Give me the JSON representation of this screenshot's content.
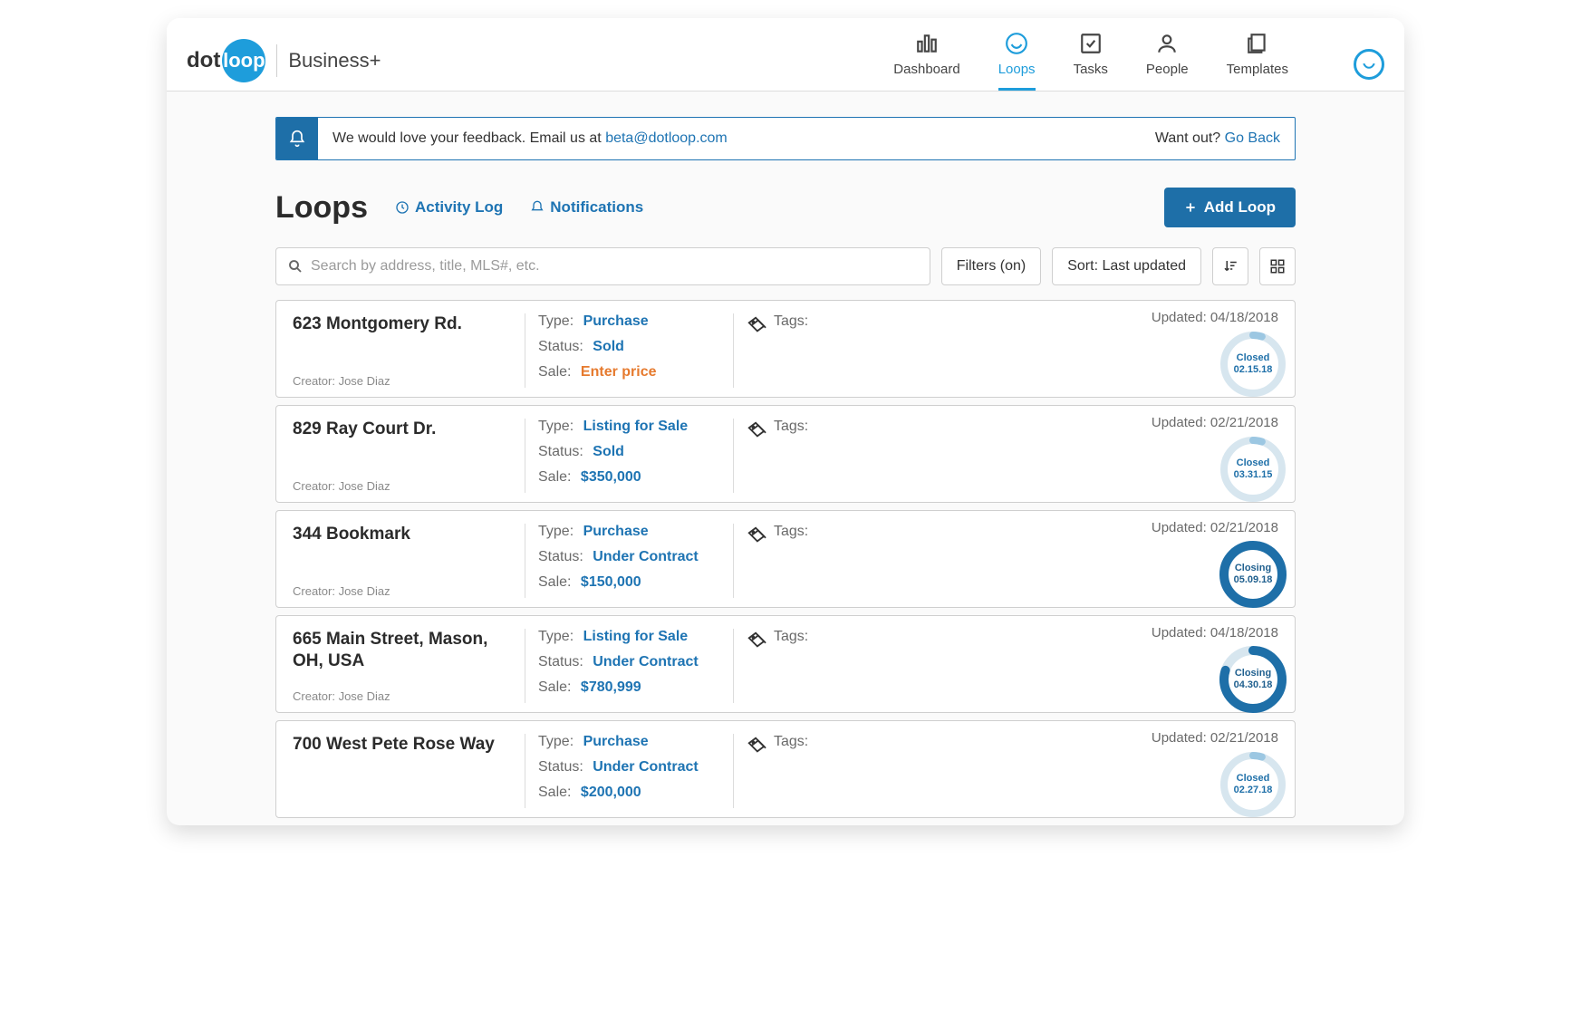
{
  "brand": {
    "dot": "dot",
    "loop": "loop",
    "plan": "Business+"
  },
  "nav": {
    "items": [
      {
        "label": "Dashboard"
      },
      {
        "label": "Loops"
      },
      {
        "label": "Tasks"
      },
      {
        "label": "People"
      },
      {
        "label": "Templates"
      }
    ]
  },
  "alert": {
    "text_prefix": "We would love your feedback. Email us at ",
    "email": "beta@dotloop.com",
    "wantout_prefix": "Want out? ",
    "wantout_link": "Go Back"
  },
  "page": {
    "title": "Loops",
    "activity_link": "Activity Log",
    "notifications_link": "Notifications",
    "add_button": "Add Loop"
  },
  "toolbar": {
    "search_placeholder": "Search by address, title, MLS#, etc.",
    "filters_label": "Filters (on)",
    "sort_label": "Sort: Last updated"
  },
  "labels": {
    "type": "Type:",
    "status": "Status:",
    "sale": "Sale:",
    "tags": "Tags:",
    "updated": "Updated:",
    "creator": "Creator:"
  },
  "loops": [
    {
      "address": "623 Montgomery Rd.",
      "creator": "Jose Diaz",
      "type": "Purchase",
      "status": "Sold",
      "sale": "Enter price",
      "sale_is_warn": true,
      "updated": "04/18/2018",
      "ring": {
        "label": "Closed",
        "date": "02.15.18",
        "pct": 5,
        "style": "thin"
      }
    },
    {
      "address": "829 Ray Court Dr.",
      "creator": "Jose Diaz",
      "type": "Listing for Sale",
      "status": "Sold",
      "sale": "$350,000",
      "sale_is_warn": false,
      "updated": "02/21/2018",
      "ring": {
        "label": "Closed",
        "date": "03.31.15",
        "pct": 5,
        "style": "thin"
      }
    },
    {
      "address": "344 Bookmark",
      "creator": "Jose Diaz",
      "type": "Purchase",
      "status": "Under Contract",
      "sale": "$150,000",
      "sale_is_warn": false,
      "updated": "02/21/2018",
      "ring": {
        "label": "Closing",
        "date": "05.09.18",
        "pct": 100,
        "style": "thick"
      }
    },
    {
      "address": "665 Main Street, Mason, OH, USA",
      "creator": "Jose Diaz",
      "type": "Listing for Sale",
      "status": "Under Contract",
      "sale": "$780,999",
      "sale_is_warn": false,
      "updated": "04/18/2018",
      "ring": {
        "label": "Closing",
        "date": "04.30.18",
        "pct": 80,
        "style": "thick"
      }
    },
    {
      "address": "700 West Pete Rose Way",
      "creator": "",
      "type": "Purchase",
      "status": "Under Contract",
      "sale": "$200,000",
      "sale_is_warn": false,
      "updated": "02/21/2018",
      "ring": {
        "label": "Closed",
        "date": "02.27.18",
        "pct": 5,
        "style": "thin"
      }
    }
  ]
}
